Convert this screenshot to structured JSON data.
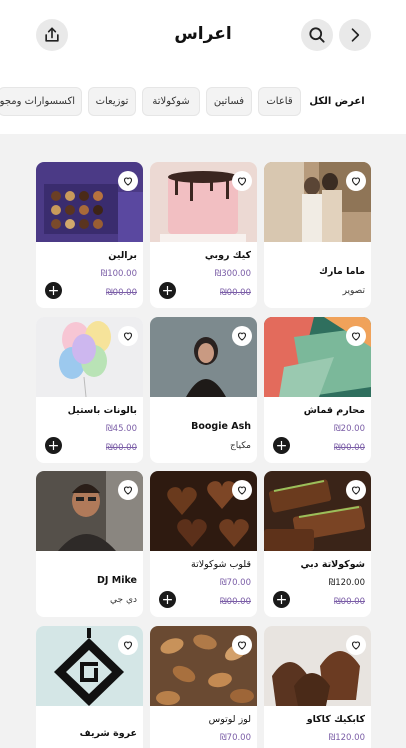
{
  "header": {
    "title": "اعراس"
  },
  "filters": {
    "items": [
      {
        "label": "اعرض الكل",
        "active": true
      },
      {
        "label": "قاعات"
      },
      {
        "label": "فساتين"
      },
      {
        "label": "شوكولاتة"
      },
      {
        "label": "توزيعات"
      },
      {
        "label": "اكسسوارات ومجوهرات"
      }
    ]
  },
  "cards": [
    {
      "name": "ماما مارك",
      "subtitle": "تصوير"
    },
    {
      "name": "كيك روبي",
      "price": "₪300.00",
      "old_price": "₪00.00"
    },
    {
      "name": "برالين",
      "price": "₪100.00",
      "old_price": "₪00.00"
    },
    {
      "name": "محارم قماش",
      "price": "₪20.00",
      "old_price": "₪00.00"
    },
    {
      "name": "Boogie Ash",
      "subtitle": "مكياج"
    },
    {
      "name": "بالونات باستيل",
      "price": "₪45.00",
      "old_price": "₪00.00"
    },
    {
      "name": "شوكولاتة دبي",
      "price": "₪120.00",
      "old_price": "₪00.00"
    },
    {
      "name": "قلوب شوكولاتة",
      "price": "₪70.00",
      "old_price": "₪00.00"
    },
    {
      "name": "DJ Mike",
      "subtitle": "دي جي"
    },
    {
      "name": "كابكيك كاكاو",
      "price": "₪120.00"
    },
    {
      "name": "لوز لوتوس",
      "price": "₪70.00"
    },
    {
      "name": "عروة شريف"
    }
  ]
}
